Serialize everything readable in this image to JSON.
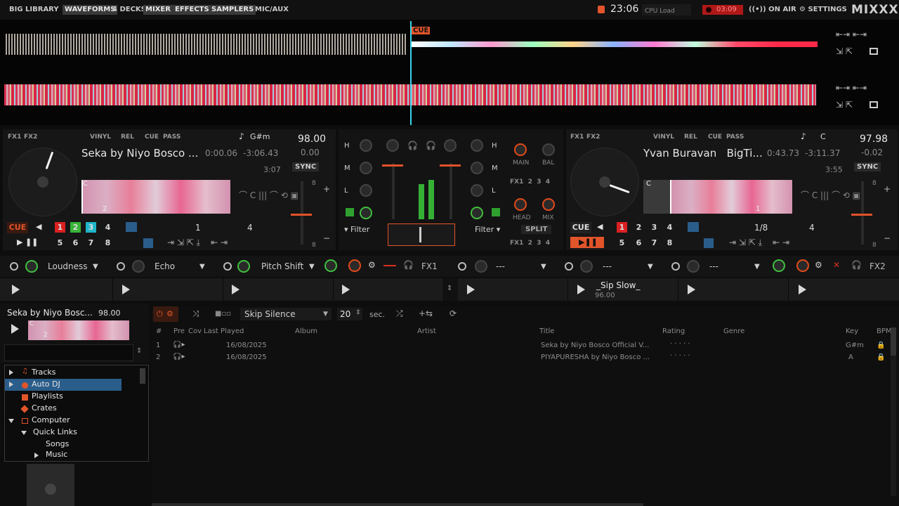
{
  "topbar": {
    "big_library": "BIG LIBRARY",
    "waveforms": "WAVEFORMS",
    "four_decks": "4 DECKS",
    "mixer": "MIXER",
    "effects": "EFFECTS",
    "samplers": "SAMPLERS",
    "mic_aux": "MIC/AUX",
    "clock": "23:06",
    "cpu_load": "CPU Load",
    "rec_time": "03:09",
    "on_air": "ON AIR",
    "settings": "SETTINGS",
    "logo": "MIXXX"
  },
  "waveform": {
    "cue_marker": "CUE"
  },
  "deck1": {
    "fx1": "FX1",
    "fx2": "FX2",
    "vinyl": "VINYL",
    "rel": "REL",
    "cue": "CUE",
    "pass": "PASS",
    "key": "G#m",
    "bpm": "98.00",
    "rate": "0.00",
    "title": "Seka by  Niyo Bosco ...",
    "elapsed": "0:00.06",
    "remaining": "-3:06.43",
    "duration": "3:07",
    "sync": "SYNC",
    "cue_button": "CUE",
    "hotcues_top": [
      "1",
      "2",
      "3",
      "4"
    ],
    "hotcues_bottom": [
      "5",
      "6",
      "7",
      "8"
    ],
    "beatjump": "1",
    "loop_size": "4",
    "wave_marker_c": "C",
    "wave_marker_2": "2",
    "rate_scale_top": "8",
    "rate_scale_bottom": "8"
  },
  "deck2": {
    "fx1": "FX1",
    "fx2": "FX2",
    "vinyl": "VINYL",
    "rel": "REL",
    "cue": "CUE",
    "pass": "PASS",
    "key": "C",
    "bpm": "97.98",
    "rate": "-0.02",
    "artist": "Yvan Buravan",
    "title": "BigTi...",
    "elapsed": "0:43.73",
    "remaining": "-3:11.37",
    "duration": "3:55",
    "sync": "SYNC",
    "cue_button": "CUE",
    "hotcues_top": [
      "1",
      "2",
      "3",
      "4"
    ],
    "hotcues_bottom": [
      "5",
      "6",
      "7",
      "8"
    ],
    "beatjump": "1/8",
    "loop_size": "4",
    "wave_marker_c": "C",
    "wave_marker_1": "1",
    "rate_scale_top": "8",
    "rate_scale_bottom": "8"
  },
  "mixer": {
    "eq_h": "H",
    "eq_m": "M",
    "eq_l": "L",
    "filter_left": "Filter",
    "filter_right": "Filter",
    "main": "MAIN",
    "bal": "BAL",
    "head": "HEAD",
    "mix": "MIX",
    "split": "SPLIT",
    "fx_assign_top": [
      "FX1",
      "2",
      "3",
      "4"
    ],
    "fx_assign_bottom": [
      "FX1",
      "2",
      "3",
      "4"
    ]
  },
  "effects": {
    "unit1_effects": [
      "Loudness",
      "Echo",
      "Pitch Shift"
    ],
    "unit1_label": "FX1",
    "unit2_effects": [
      "---",
      "---",
      "---"
    ],
    "unit2_label": "FX2"
  },
  "samplers": {
    "sampler6_title": "_Sip Slow_",
    "sampler6_bpm": "96.00"
  },
  "preview_deck": {
    "title": "Seka by  Niyo Bosc...",
    "bpm": "98.00",
    "marker_c": "C",
    "marker_2": "2"
  },
  "autodj": {
    "skip_silence": "Skip Silence",
    "fade_seconds": "20",
    "unit": "sec."
  },
  "library": {
    "columns": [
      "#",
      "Pre",
      "Cov",
      "Last Played",
      "Album",
      "Artist",
      "Title",
      "Rating",
      "Genre",
      "Key",
      "BPM"
    ],
    "rows": [
      {
        "num": "1",
        "last_played": "16/08/2025",
        "title": "Seka by  Niyo Bosco Official V...",
        "rating": "· · · · ·",
        "key": "G#m"
      },
      {
        "num": "2",
        "last_played": "16/08/2025",
        "title": "PIYAPURESHA by Niyo Bosco ...",
        "rating": "· · · · ·",
        "key": "A"
      }
    ]
  },
  "sidebar": {
    "items": [
      {
        "label": "Tracks",
        "icon": "music-note-icon"
      },
      {
        "label": "Auto DJ",
        "icon": "autodj-icon"
      },
      {
        "label": "Playlists",
        "icon": "playlist-icon"
      },
      {
        "label": "Crates",
        "icon": "crate-icon"
      },
      {
        "label": "Computer",
        "icon": "computer-icon"
      },
      {
        "label": "Quick Links"
      },
      {
        "label": "Songs"
      },
      {
        "label": "Music"
      }
    ]
  },
  "colors": {
    "accent": "#e2542a",
    "hotcue1": "#d92020",
    "hotcue2": "#38b438",
    "hotcue3": "#1fb5c8",
    "selection": "#2a5d8a"
  }
}
